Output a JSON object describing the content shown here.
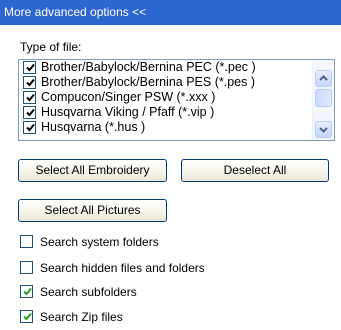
{
  "header": {
    "title": "More advanced options <<"
  },
  "file_type": {
    "label": "Type of file:",
    "items": [
      {
        "label": "Brother/Babylock/Bernina PEC (*.pec )",
        "checked": true
      },
      {
        "label": "Brother/Babylock/Bernina PES (*.pes )",
        "checked": true
      },
      {
        "label": "Compucon/Singer PSW (*.xxx )",
        "checked": true
      },
      {
        "label": "Husqvarna Viking / Pfaff (*.vip )",
        "checked": true
      },
      {
        "label": "Husqvarna (*.hus )",
        "checked": true
      }
    ]
  },
  "buttons": {
    "select_all_embroidery": "Select All Embroidery",
    "deselect_all": "Deselect All",
    "select_all_pictures": "Select All Pictures"
  },
  "options": [
    {
      "label": "Search system folders",
      "checked": false
    },
    {
      "label": "Search hidden files and folders",
      "checked": false
    },
    {
      "label": "Search subfolders",
      "checked": true
    },
    {
      "label": "Search Zip files",
      "checked": true
    }
  ],
  "colors": {
    "header_bg": "#2c66cf",
    "checkmark": "#21a121",
    "checkbox_border": "#1c5180"
  }
}
